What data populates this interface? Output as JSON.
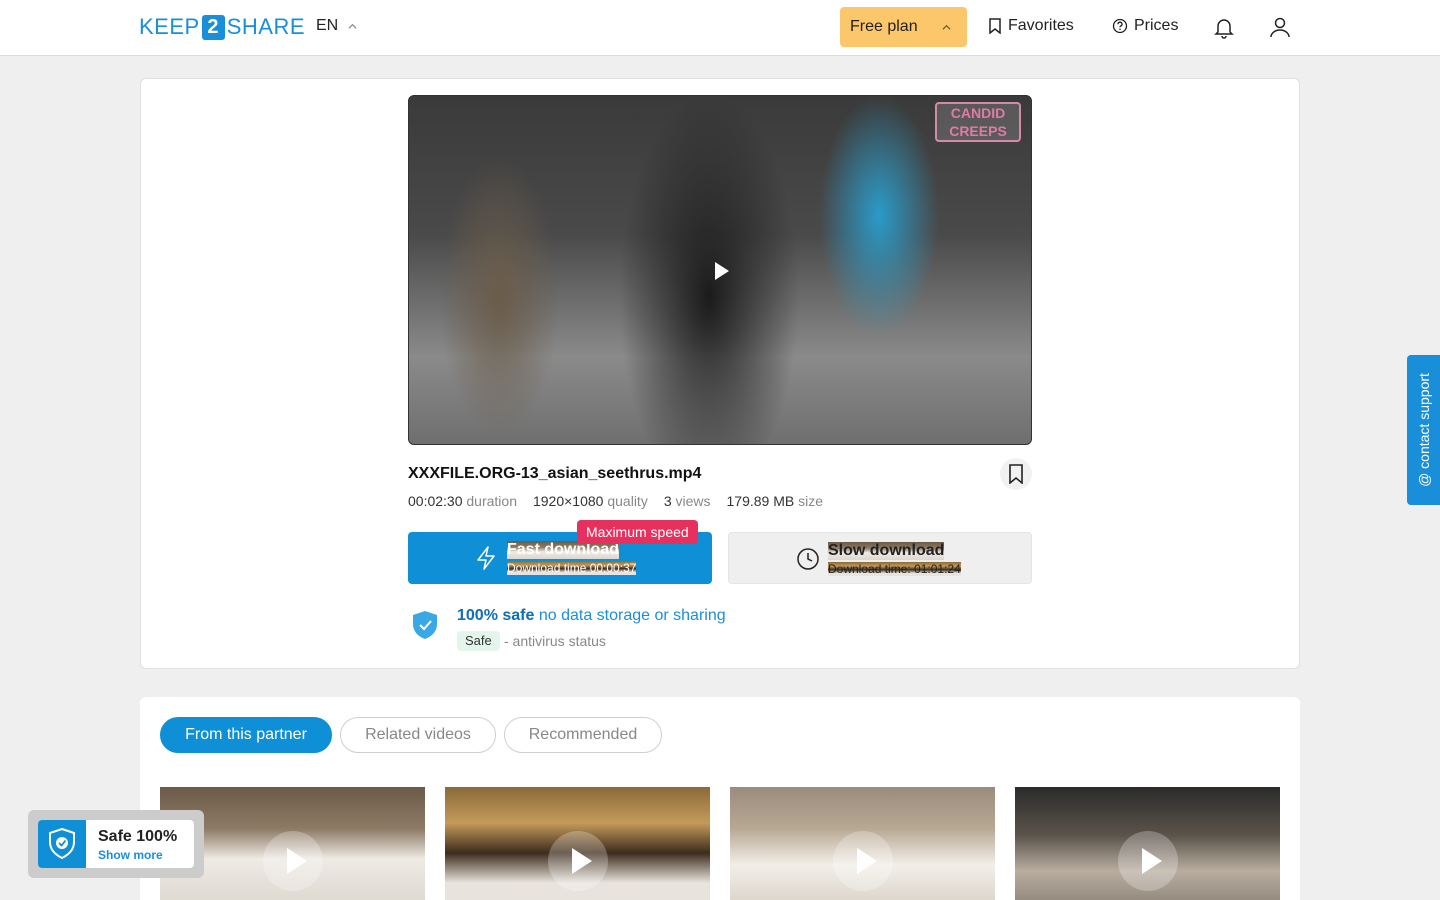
{
  "header": {
    "logo_left": "KEEP",
    "logo_num": "2",
    "logo_right": "SHARE",
    "lang": "EN",
    "plan": "Free plan",
    "favorites": "Favorites",
    "prices": "Prices"
  },
  "video": {
    "watermark": "CANDID CREEPS",
    "file_name": "XXXFILE.ORG-13_asian_seethrus.mp4",
    "duration_value": "00:02:30",
    "duration_label": "duration",
    "quality_value": "1920×1080",
    "quality_label": "quality",
    "views_value": "3",
    "views_label": "views",
    "size_value": "179.89 MB",
    "size_label": "size"
  },
  "download": {
    "badge": "Maximum speed",
    "fast_title": "Fast download",
    "fast_time": "Download time 00:00:37",
    "slow_title": "Slow download",
    "slow_time": "Download time: 01:01:24"
  },
  "safety": {
    "title_bold": "100% safe",
    "title_link": "no data storage or sharing",
    "tag": "Safe",
    "status": "- antivirus status"
  },
  "support": {
    "label": "@ contact support"
  },
  "tabs": [
    "From this partner",
    "Related videos",
    "Recommended"
  ],
  "safe_widget": {
    "title": "Safe 100%",
    "link": "Show more"
  },
  "colors": {
    "brand": "#1a8fd9",
    "plan": "#fcc66b",
    "badge": "#e6305e"
  }
}
